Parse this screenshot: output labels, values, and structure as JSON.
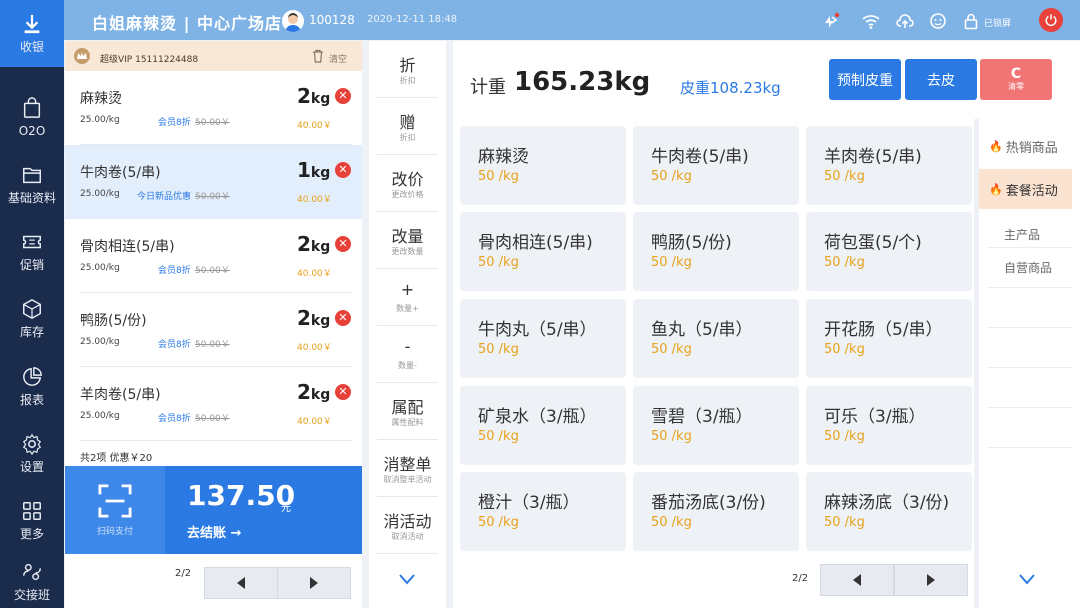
{
  "nav": [
    {
      "label": "收银",
      "icon": "cashier-icon",
      "active": true
    },
    {
      "label": "O2O",
      "icon": "bag-icon"
    },
    {
      "label": "基础资料",
      "icon": "folder-icon"
    },
    {
      "label": "促销",
      "icon": "ticket-icon"
    },
    {
      "label": "库存",
      "icon": "box-icon"
    },
    {
      "label": "报表",
      "icon": "pie-chart-icon"
    },
    {
      "label": "设置",
      "icon": "gear-icon"
    },
    {
      "label": "更多",
      "icon": "grid-icon"
    },
    {
      "label": "交接班",
      "icon": "handover-icon"
    }
  ],
  "topbar": {
    "store": "白姐麻辣烫 | 中心广场店",
    "user_id": "100128",
    "datetime": "2020-12-11  18:48",
    "lock_label": "已锁屏"
  },
  "order": {
    "vip": "超级VIP  15111224488",
    "clear": "清空",
    "items": [
      {
        "name": "麻辣烫",
        "price": "25.00/kg",
        "promo": "会员8折",
        "orig": "50.00￥",
        "qty": "2",
        "unit": "kg",
        "subtotal": "40.00￥"
      },
      {
        "name": "牛肉卷(5/串)",
        "price": "25.00/kg",
        "promo": "今日新品优惠",
        "orig": "50.00￥",
        "qty": "1",
        "unit": "kg",
        "subtotal": "40.00￥"
      },
      {
        "name": "骨肉相连(5/串)",
        "price": "25.00/kg",
        "promo": "会员8折",
        "orig": "50.00￥",
        "qty": "2",
        "unit": "kg",
        "subtotal": "40.00￥"
      },
      {
        "name": "鸭肠(5/份)",
        "price": "25.00/kg",
        "promo": "会员8折",
        "orig": "50.00￥",
        "qty": "2",
        "unit": "kg",
        "subtotal": "40.00￥"
      },
      {
        "name": "羊肉卷(5/串)",
        "price": "25.00/kg",
        "promo": "会员8折",
        "orig": "50.00￥",
        "qty": "2",
        "unit": "kg",
        "subtotal": "40.00￥"
      }
    ],
    "summary": "共2项   优惠￥20",
    "scan_label": "扫码支付",
    "total": "137.50",
    "total_unit": "元",
    "checkout": "去结账 →",
    "page": "2/2"
  },
  "actions": [
    {
      "main": "折",
      "sub": "折扣"
    },
    {
      "main": "赠",
      "sub": "折扣"
    },
    {
      "main": "改价",
      "sub": "更改价格"
    },
    {
      "main": "改量",
      "sub": "更改数量"
    },
    {
      "main": "+",
      "sub": "数量+"
    },
    {
      "main": "-",
      "sub": "数量-"
    },
    {
      "main": "属配",
      "sub": "属性配料"
    },
    {
      "main": "消整单",
      "sub": "取消整单活动"
    },
    {
      "main": "消活动",
      "sub": "取消活动"
    }
  ],
  "weigh": {
    "label": "计重",
    "value": "165.23kg",
    "tare": "皮重108.23kg",
    "preset_tare": "预制皮重",
    "remove_tare": "去皮",
    "zero_main": "C",
    "zero_sub": "清零"
  },
  "products": [
    {
      "name": "麻辣烫",
      "price": "50 /kg"
    },
    {
      "name": "牛肉卷(5/串)",
      "price": "50 /kg"
    },
    {
      "name": "羊肉卷(5/串)",
      "price": "50 /kg"
    },
    {
      "name": "骨肉相连(5/串)",
      "price": "50 /kg"
    },
    {
      "name": "鸭肠(5/份)",
      "price": "50 /kg"
    },
    {
      "name": "荷包蛋(5/个)",
      "price": "50 /kg"
    },
    {
      "name": "牛肉丸（5/串）",
      "price": "50 /kg"
    },
    {
      "name": "鱼丸（5/串）",
      "price": "50 /kg"
    },
    {
      "name": "开花肠（5/串）",
      "price": "50 /kg"
    },
    {
      "name": "矿泉水（3/瓶）",
      "price": "50 /kg"
    },
    {
      "name": "雪碧（3/瓶）",
      "price": "50 /kg"
    },
    {
      "name": "可乐（3/瓶）",
      "price": "50 /kg"
    },
    {
      "name": "橙汁（3/瓶）",
      "price": "50 /kg"
    },
    {
      "name": "番茄汤底(3/份)",
      "price": "50 /kg"
    },
    {
      "name": "麻辣汤底（3/份)",
      "price": "50 /kg"
    }
  ],
  "grid_page": "2/2",
  "categories": [
    {
      "label": "热销商品"
    },
    {
      "label": "套餐活动",
      "active": true
    }
  ],
  "subcategories": [
    "主产品",
    "自营商品"
  ],
  "colors": {
    "accent": "#2b7ae4",
    "nav_bg": "#1b2b4b",
    "topbar": "#7fb2e5",
    "price": "#e8a21b",
    "danger": "#e8413a"
  }
}
